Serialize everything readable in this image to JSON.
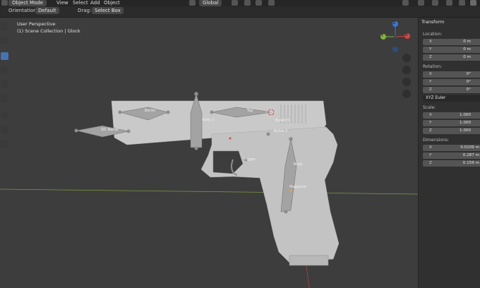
{
  "header": {
    "mode": "Object Mode",
    "menu": [
      "View",
      "Select",
      "Add",
      "Object"
    ],
    "transform_orientation": "Global",
    "orientation_label": "Orientation:",
    "orientation_value": "Default",
    "drag_label": "Drag:",
    "drag_value": "Select Box"
  },
  "viewport": {
    "perspective": "User Perspective",
    "collection": "(1) Scene Collection | Glock",
    "gizmo": {
      "x": "X",
      "y": "Y",
      "z": "Z"
    }
  },
  "bone_labels": [
    "Barrel",
    "Top",
    "Body 2",
    "SIC Barrel",
    "Bullet 3",
    "Bullet 3",
    "Trigger",
    "Body",
    "Magazine"
  ],
  "panel": {
    "title": "Transform",
    "location_label": "Location:",
    "location": [
      {
        "axis": "X",
        "value": "0 m"
      },
      {
        "axis": "Y",
        "value": "0 m"
      },
      {
        "axis": "Z",
        "value": "0 m"
      }
    ],
    "rotation_label": "Rotation:",
    "rotation": [
      {
        "axis": "X",
        "value": "0°"
      },
      {
        "axis": "Y",
        "value": "0°"
      },
      {
        "axis": "Z",
        "value": "0°"
      }
    ],
    "rotation_mode": "XYZ Euler",
    "scale_label": "Scale:",
    "scale": [
      {
        "axis": "X",
        "value": "1.000"
      },
      {
        "axis": "Y",
        "value": "1.000"
      },
      {
        "axis": "Z",
        "value": "1.000"
      }
    ],
    "dimensions_label": "Dimensions:",
    "dimensions": [
      {
        "axis": "X",
        "value": "0.0109 m"
      },
      {
        "axis": "Y",
        "value": "0.287 m"
      },
      {
        "axis": "Z",
        "value": "0.159 m"
      }
    ]
  }
}
